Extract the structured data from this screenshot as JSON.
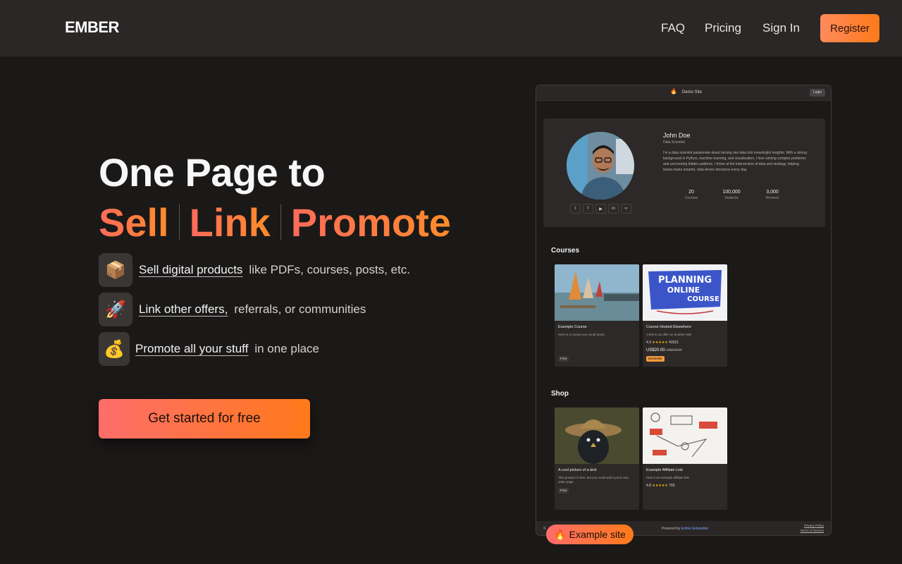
{
  "nav": {
    "logo": "EMBER",
    "faq": "FAQ",
    "pricing": "Pricing",
    "signin": "Sign In",
    "register": "Register"
  },
  "hero": {
    "line1": "One Page to",
    "words": [
      "Sell",
      "Link",
      "Promote"
    ],
    "features": [
      {
        "icon": "📦",
        "icon_name": "package-icon",
        "link": "Sell digital products",
        "rest": "like PDFs, courses, posts, etc."
      },
      {
        "icon": "🚀",
        "icon_name": "rocket-icon",
        "link": "Link other offers,",
        "rest": "referrals, or communities"
      },
      {
        "icon": "💰",
        "icon_name": "money-bag-icon",
        "link": "Promote all your stuff",
        "rest": "in one place"
      }
    ],
    "cta": "Get started for free"
  },
  "demo": {
    "site_title": "Demo Site",
    "login": "Login",
    "profile": {
      "name": "John Doe",
      "role": "Data Scientist",
      "bio": "I'm a data scientist passionate about turning raw data into meaningful insights. With a strong background in Python, machine learning, and visualization, I love solving complex problems and uncovering hidden patterns. I thrive at the intersection of data and strategy, helping teams make smarter, data-driven decisions every day.",
      "stats": [
        {
          "value": "20",
          "label": "Courses"
        },
        {
          "value": "100,000",
          "label": "Students"
        },
        {
          "value": "3,000",
          "label": "Reviews"
        }
      ],
      "socials": [
        "twitter-icon",
        "facebook-icon",
        "youtube-icon",
        "linkedin-icon",
        "link-icon"
      ]
    },
    "courses_title": "Courses",
    "courses": [
      {
        "title": "Example Course",
        "desc": "Here is a course you could teach.",
        "badge": "Free"
      },
      {
        "title": "Course Hosted Elsewhere",
        "desc": "A link to an offer on another site!",
        "rating": "4.9",
        "stars": "★★★★★",
        "reviews": "43021",
        "price": "US$20.00",
        "old_price": "US$40.00",
        "badge": "Bestseller"
      }
    ],
    "shop_title": "Shop",
    "shop": [
      {
        "title": "A cool picture of a bird",
        "desc": "This product is free, but you could add a price and sales page.",
        "badge": "Free"
      },
      {
        "title": "Example Affiliate Link",
        "desc": "Here's an example affiliate link",
        "rating": "4.8",
        "stars": "★★★★★",
        "reviews": "700"
      }
    ],
    "footer": {
      "copy": "©",
      "powered_label": "Powered by",
      "powered_brand": "Ember Education",
      "privacy": "Privacy Policy",
      "terms": "Terms of Service"
    }
  },
  "example_pill": {
    "icon": "🔥",
    "label": "Example site"
  },
  "colors": {
    "accent_start": "#ff6d6b",
    "accent_end": "#ff7a1a",
    "background": "#1b1918",
    "topbar": "#2a2726"
  }
}
